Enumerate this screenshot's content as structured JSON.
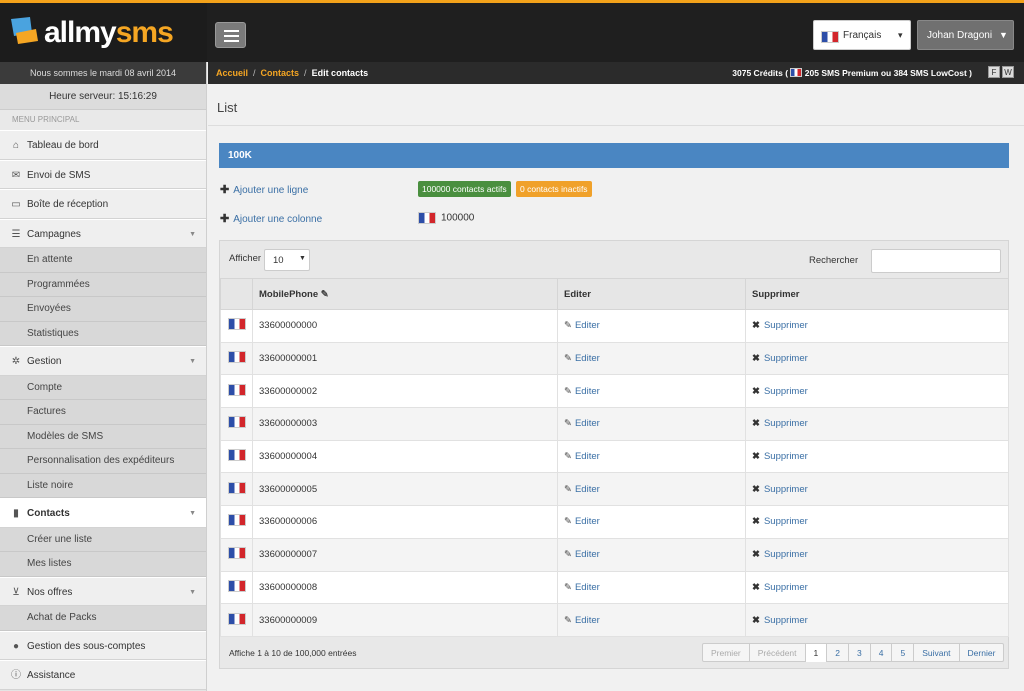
{
  "app": {
    "logo_text_white": "allmy",
    "logo_text_orange": "sms"
  },
  "header": {
    "language": "Français",
    "user": "Johan Dragoni"
  },
  "sidebar": {
    "date_line": "Nous sommes le mardi 08 avril 2014",
    "server_time": "Heure serveur: 15:16:29",
    "menu_title": "MENU PRINCIPAL",
    "items": [
      {
        "label": "Tableau de bord",
        "icon": "home-icon"
      },
      {
        "label": "Envoi de SMS",
        "icon": "envelope-icon"
      },
      {
        "label": "Boîte de réception",
        "icon": "inbox-icon"
      },
      {
        "label": "Campagnes",
        "icon": "list-icon",
        "sub": [
          "En attente",
          "Programmées",
          "Envoyées",
          "Statistiques"
        ]
      },
      {
        "label": "Gestion",
        "icon": "gear-icon",
        "sub": [
          "Compte",
          "Factures",
          "Modèles de SMS",
          "Personnalisation des expéditeurs",
          "Liste noire"
        ]
      },
      {
        "label": "Contacts",
        "icon": "book-icon",
        "sub": [
          "Créer une liste",
          "Mes listes"
        ]
      },
      {
        "label": "Nos offres",
        "icon": "cart-icon",
        "sub": [
          "Achat de Packs"
        ]
      },
      {
        "label": "Gestion des sous-comptes",
        "icon": "user-icon"
      },
      {
        "label": "Assistance",
        "icon": "info-icon"
      }
    ]
  },
  "breadcrumb": {
    "home": "Accueil",
    "contacts": "Contacts",
    "current": "Edit contacts"
  },
  "credits": {
    "prefix": "3075 Crédits (",
    "detail": "205 SMS Premium ou 384 SMS LowCost )",
    "f": "F",
    "w": "W"
  },
  "main": {
    "page_title": "List",
    "panel_title": "100K",
    "add_row": "Ajouter une ligne",
    "add_col": "Ajouter une colonne",
    "badge_active": "100000 contacts actifs",
    "badge_inactive": "0 contacts inactifs",
    "country_count": "100000"
  },
  "table": {
    "show_label": "Afficher",
    "page_length": "10",
    "search_label": "Rechercher",
    "columns": [
      "",
      "MobilePhone",
      "Editer",
      "Supprimer"
    ],
    "edit_label": "Editer",
    "delete_label": "Supprimer",
    "rows": [
      "33600000000",
      "33600000001",
      "33600000002",
      "33600000003",
      "33600000004",
      "33600000005",
      "33600000006",
      "33600000007",
      "33600000008",
      "33600000009"
    ],
    "info": "Affiche 1 à 10 de 100,000 entrées",
    "pager": {
      "first": "Premier",
      "prev": "Précédent",
      "pages": [
        "1",
        "2",
        "3",
        "4",
        "5"
      ],
      "next": "Suivant",
      "last": "Dernier"
    }
  },
  "colors": {
    "accent": "#f5a623",
    "panel": "#4a86c2",
    "active_badge": "#4a8f3f",
    "inactive_badge": "#f0a12a"
  }
}
